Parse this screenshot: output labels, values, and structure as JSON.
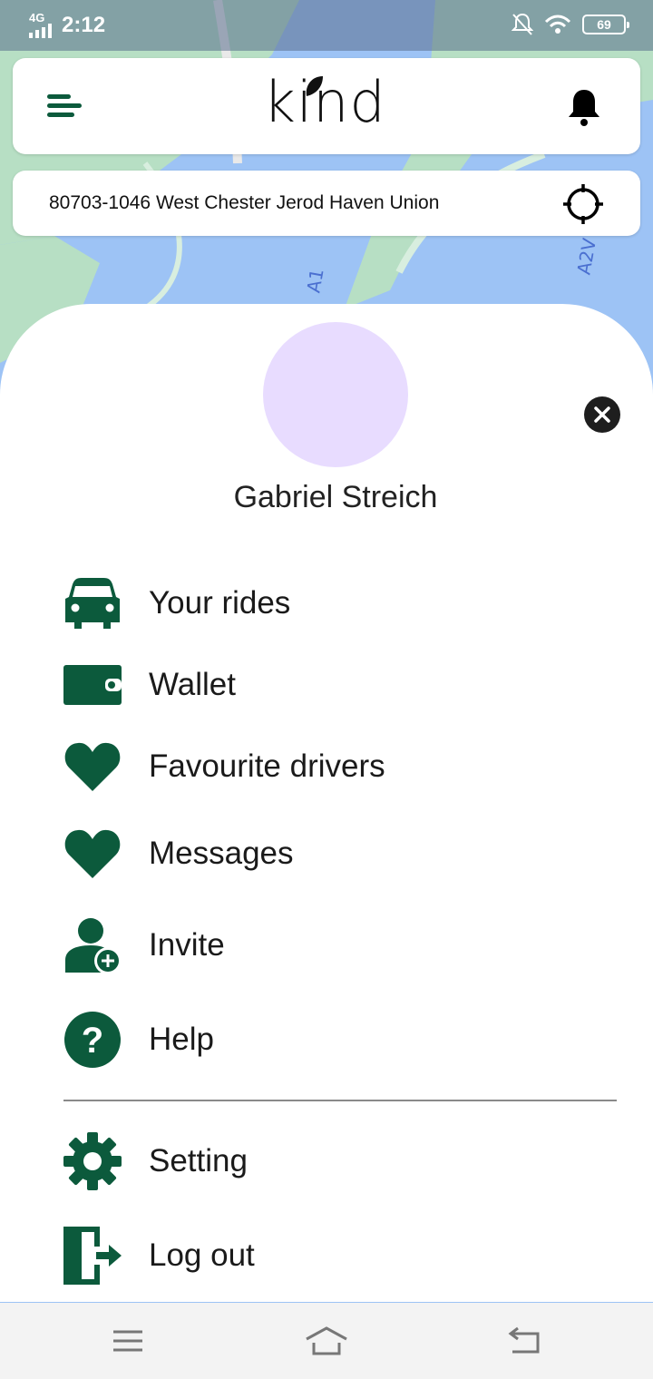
{
  "status_bar": {
    "network": "4G",
    "time": "2:12",
    "battery": "69",
    "icons": [
      "signal-icon",
      "notifications-off-icon",
      "wifi-icon",
      "battery-icon"
    ]
  },
  "header": {
    "menu_icon": "menu-icon",
    "logo_text": "kind",
    "bell_icon": "bell-icon"
  },
  "map": {
    "road_label_1": "A1",
    "road_label_2": "A2V"
  },
  "address_bar": {
    "address": "80703-1046 West Chester Jerod Haven Union",
    "locate_icon": "crosshair-icon"
  },
  "drawer": {
    "user_name": "Gabriel Streich",
    "close_icon": "close-icon",
    "menu_items": [
      {
        "label": "Your rides",
        "icon": "car-icon"
      },
      {
        "label": "Wallet",
        "icon": "wallet-icon"
      },
      {
        "label": "Favourite drivers",
        "icon": "heart-icon"
      },
      {
        "label": "Messages",
        "icon": "heart-icon"
      },
      {
        "label": "Invite",
        "icon": "add-person-icon"
      },
      {
        "label": "Help",
        "icon": "help-icon"
      }
    ],
    "secondary_items": [
      {
        "label": "Setting",
        "icon": "gear-icon"
      },
      {
        "label": "Log out",
        "icon": "logout-icon"
      }
    ]
  },
  "colors": {
    "brand_green": "#0c5a3c",
    "avatar_bg": "#e8dcff",
    "map_water": "#9dc3f5",
    "map_land": "#b7dfc4"
  },
  "nav_bar": {
    "icons": [
      "recent-apps-icon",
      "home-icon",
      "back-icon"
    ]
  }
}
